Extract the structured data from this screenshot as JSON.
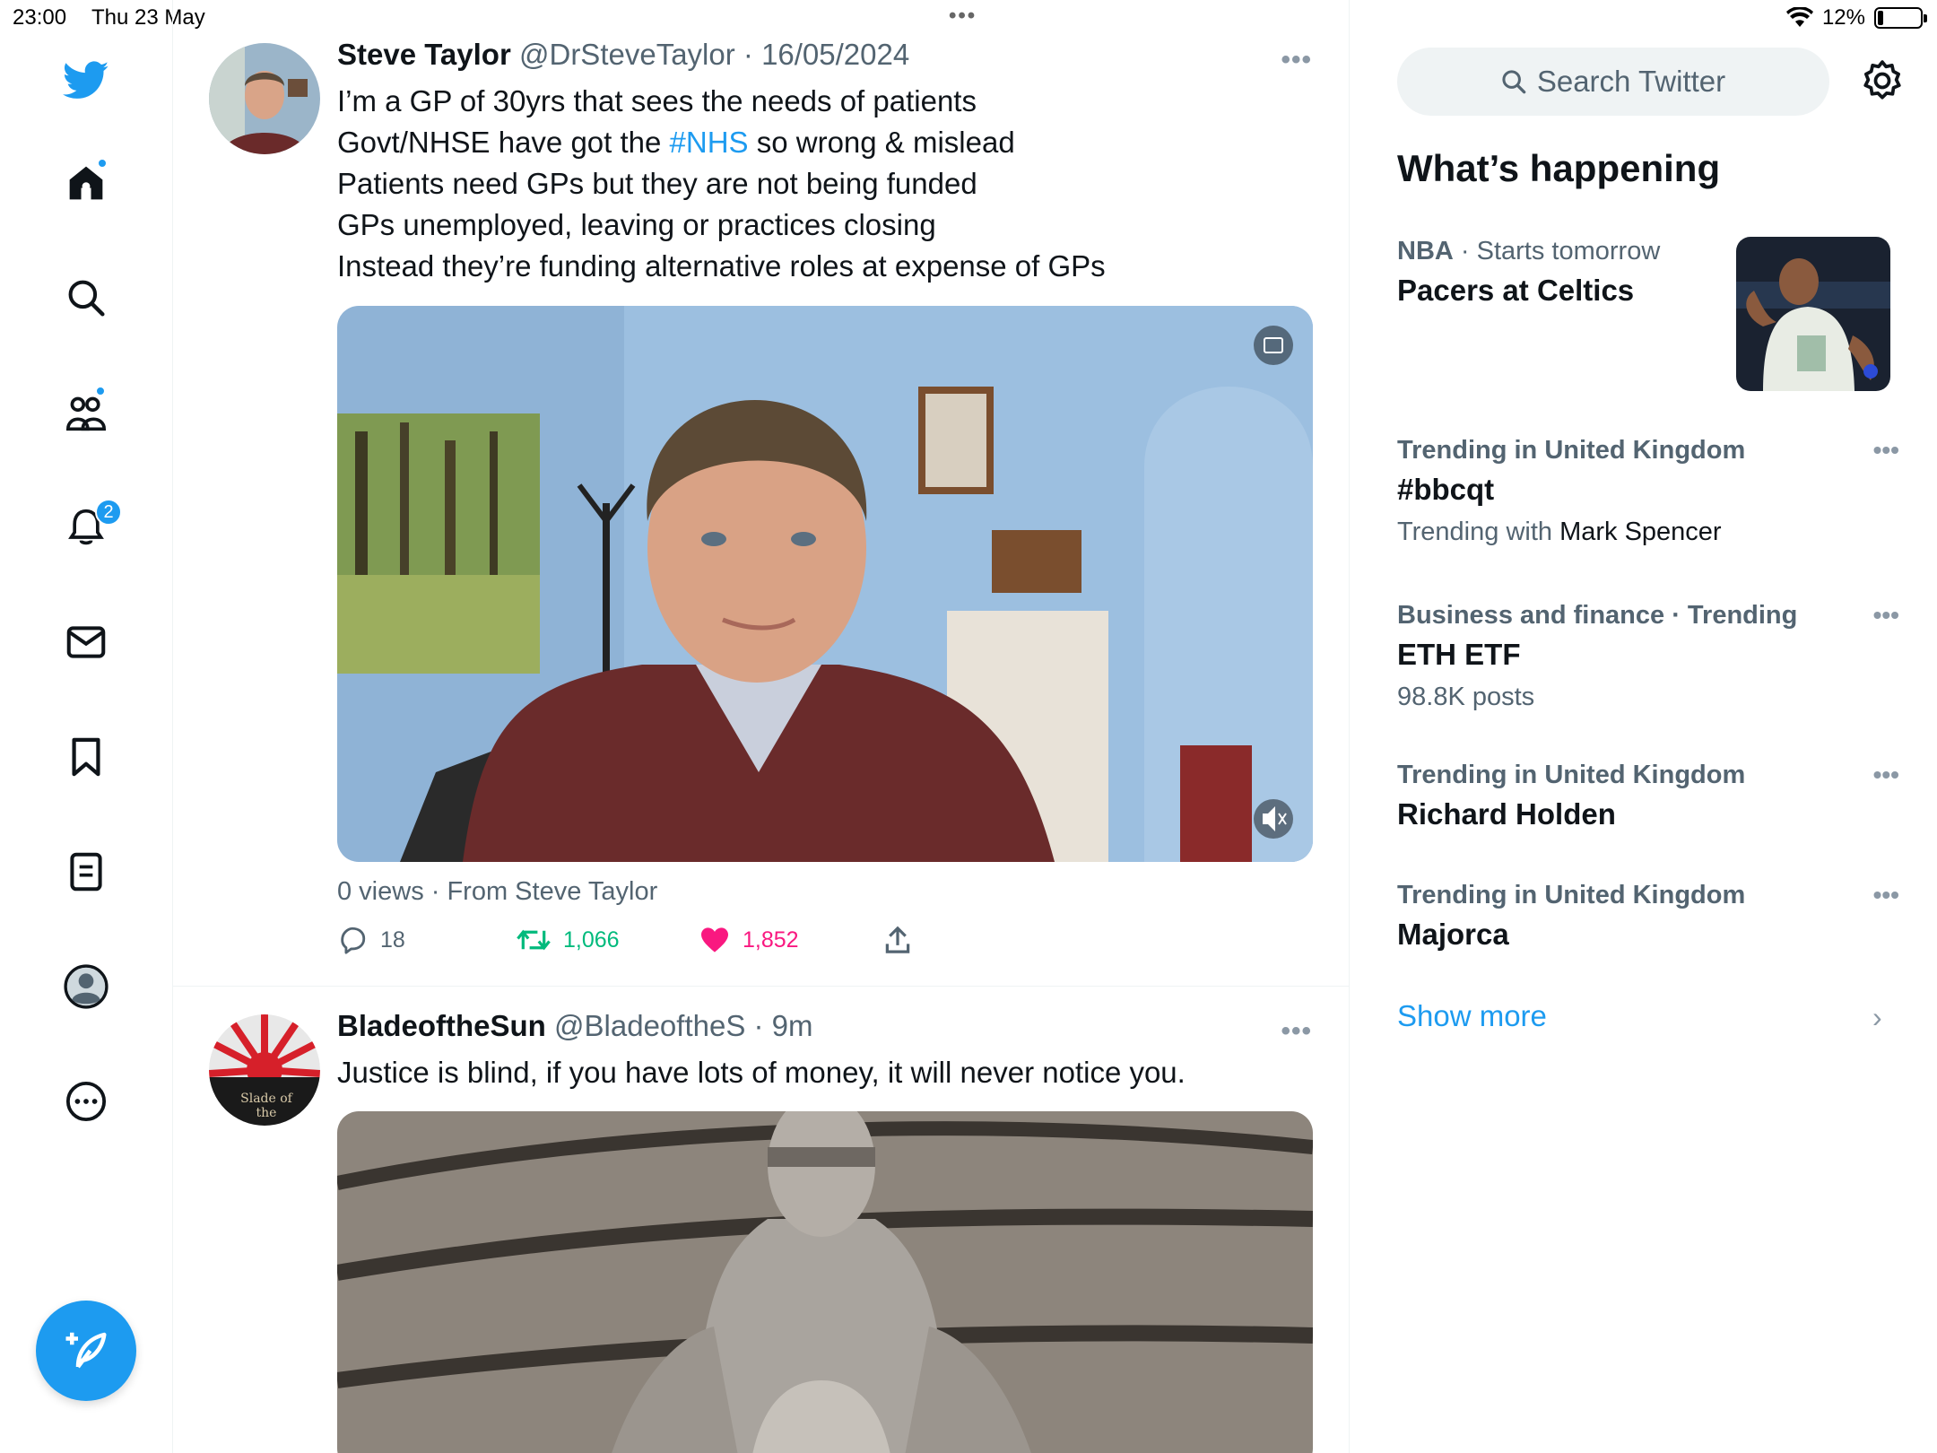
{
  "status_bar": {
    "time": "23:00",
    "date": "Thu 23 May",
    "dots": "•••",
    "battery_percent_text": "12%",
    "battery_level": 0.12
  },
  "nav": {
    "items": [
      {
        "name": "twitter-logo-icon"
      },
      {
        "name": "home-icon",
        "dot": true
      },
      {
        "name": "search-icon"
      },
      {
        "name": "communities-icon",
        "dot": true
      },
      {
        "name": "notifications-icon",
        "badge": "2"
      },
      {
        "name": "messages-icon"
      },
      {
        "name": "bookmarks-icon"
      },
      {
        "name": "lists-icon"
      },
      {
        "name": "profile-icon"
      },
      {
        "name": "more-icon"
      }
    ],
    "notification_badge": "2",
    "compose_icon": "compose-icon"
  },
  "timeline": {
    "tweets": [
      {
        "name": "Steve Taylor",
        "handle": "@DrSteveTaylor",
        "sep": "·",
        "time": "16/05/2024",
        "more": "•••",
        "lines": [
          "I’m a GP of 30yrs that sees the needs of patients",
          "Govt/NHSE have got the ",
          "#NHS",
          " so wrong & mislead",
          "Patients need GPs but they are not being funded",
          "GPs unemployed, leaving or practices closing",
          "Instead they’re funding alternative roles at expense of GPs"
        ],
        "views": "0 views · From Steve Taylor",
        "replies": "18",
        "retweets": "1,066",
        "likes": "1,852"
      },
      {
        "name": "BladeoftheSun",
        "handle": "@BladeoftheS",
        "sep": "·",
        "time": "9m",
        "more": "•••",
        "text": "Justice is blind, if you have lots of money, it will never notice you.",
        "avatar_text": "Slade of the"
      }
    ]
  },
  "sidebar": {
    "search_placeholder": "Search Twitter",
    "title": "What’s happening",
    "trends": [
      {
        "meta_bold": "NBA",
        "meta": " · Starts tomorrow",
        "name": "Pacers at Celtics",
        "has_image": true
      },
      {
        "meta_bold": "Trending in United Kingdom",
        "meta": "",
        "name": "#bbcqt",
        "sub_prefix": "Trending with ",
        "sub_dark": "Mark Spencer",
        "more": "•••"
      },
      {
        "meta_bold": "Business and finance · Trending",
        "meta": "",
        "name": "ETH ETF",
        "sub_prefix": "98.8K posts",
        "sub_dark": "",
        "more": "•••"
      },
      {
        "meta_bold": "Trending in United Kingdom",
        "meta": "",
        "name": "Richard Holden",
        "more": "•••"
      },
      {
        "meta_bold": "Trending in United Kingdom",
        "meta": "",
        "name": "Majorca",
        "more": "•••"
      }
    ],
    "show_more": "Show more",
    "chevron": "›"
  },
  "colors": {
    "accent": "#1d9bf0",
    "like": "#f91880",
    "retweet": "#00ba7c",
    "secondary_text": "#536471"
  }
}
